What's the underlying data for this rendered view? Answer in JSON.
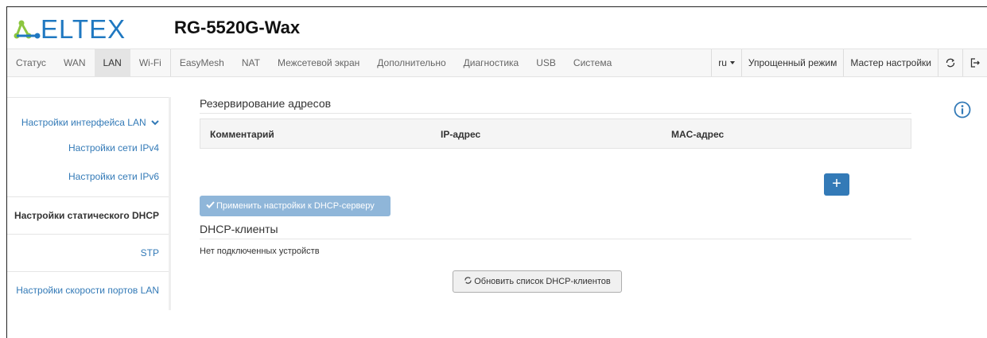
{
  "header": {
    "logo_text": "ELTEX",
    "model": "RG-5520G-Wax"
  },
  "nav": {
    "left": [
      {
        "label": "Статус"
      },
      {
        "label": "WAN"
      },
      {
        "label": "LAN",
        "active": true
      },
      {
        "label": "Wi-Fi"
      },
      {
        "label": "EasyMesh"
      },
      {
        "label": "NAT"
      },
      {
        "label": "Межсетевой экран"
      },
      {
        "label": "Дополнительно"
      },
      {
        "label": "Диагностика"
      },
      {
        "label": "USB"
      },
      {
        "label": "Система"
      }
    ],
    "lang": "ru",
    "simple_mode": "Упрощенный режим",
    "wizard": "Мастер настройки",
    "refresh_icon": "refresh-icon",
    "logout_icon": "logout-icon"
  },
  "sidebar": {
    "group_label": "Настройки интерфейса LAN",
    "items": [
      {
        "label": "Настройки сети IPv4"
      },
      {
        "label": "Настройки сети IPv6"
      },
      {
        "label": "Настройки статического DHCP",
        "active": true
      },
      {
        "label": "STP"
      },
      {
        "label": "Настройки скорости портов LAN"
      }
    ]
  },
  "main": {
    "reservation_title": "Резервирование адресов",
    "columns": [
      "Комментарий",
      "IP-адрес",
      "MAC-адрес"
    ],
    "add_label": "+",
    "apply_label": "Применить настройки к DHCP-серверу",
    "dhcp_title": "DHCP-клиенты",
    "no_clients": "Нет подключенных устройств",
    "refresh_label": "Обновить список DHCP-клиентов"
  },
  "colors": {
    "primary": "#337ab7",
    "primary_disabled": "#8fb6d9",
    "logo_green": "#8cc63f",
    "logo_blue": "#1f78c1"
  }
}
